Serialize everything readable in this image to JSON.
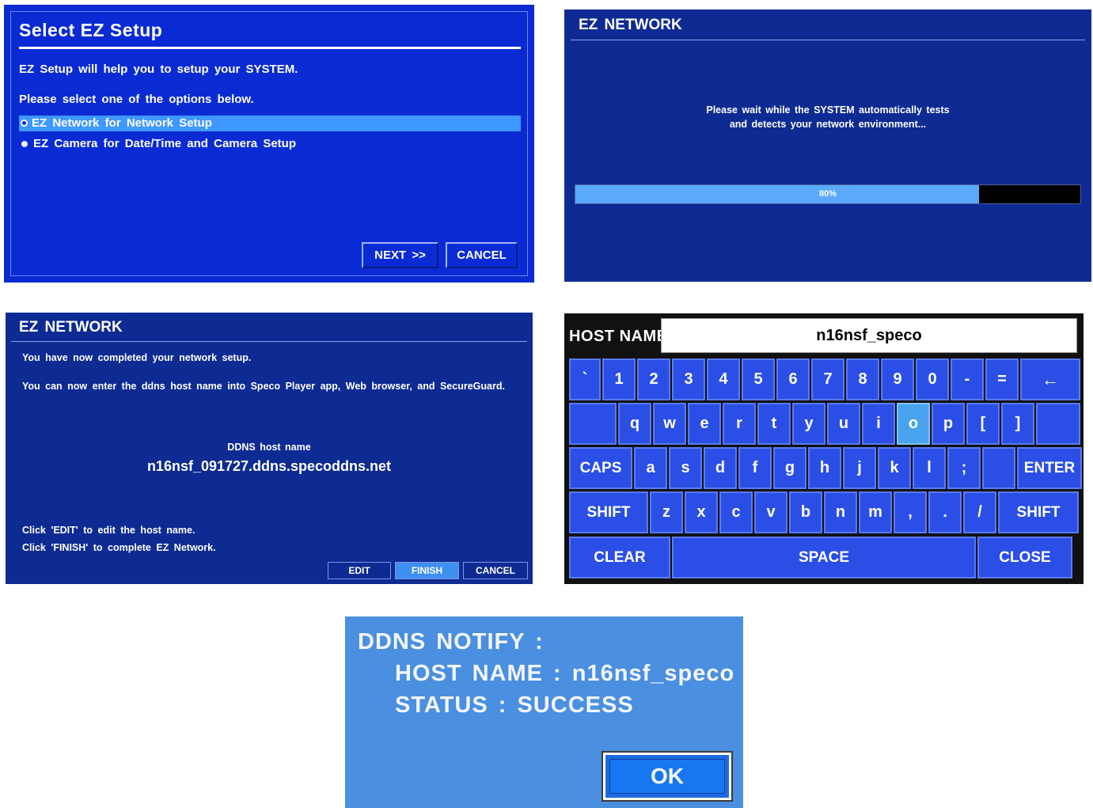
{
  "setup": {
    "title": "Select EZ Setup",
    "line1": "EZ Setup will help you to setup your SYSTEM.",
    "line2": "Please select one of the options below.",
    "options": [
      "EZ Network for Network Setup",
      "EZ Camera for Date/Time and Camera Setup"
    ],
    "next": "NEXT >>",
    "cancel": "CANCEL"
  },
  "progress": {
    "title": "EZ NETWORK",
    "msg1": "Please wait while the SYSTEM automatically tests",
    "msg2": "and detects your network environment...",
    "percent_text": "80%",
    "percent": 0.8
  },
  "complete": {
    "title": "EZ NETWORK",
    "line1": "You have now completed your network setup.",
    "line2": "You can now enter the ddns host name into Speco Player app, Web browser, and SecureGuard.",
    "host_label": "DDNS host name",
    "host_value": "n16nsf_091727.ddns.specoddns.net",
    "hint1": "Click 'EDIT' to edit the host name.",
    "hint2": "Click 'FINISH' to complete EZ Network.",
    "edit": "EDIT",
    "finish": "FINISH",
    "cancel": "CANCEL"
  },
  "keyboard": {
    "label": "HOST NAME",
    "value": "n16nsf_speco",
    "highlighted_key": "o",
    "row1": [
      "`",
      "1",
      "2",
      "3",
      "4",
      "5",
      "6",
      "7",
      "8",
      "9",
      "0",
      "-",
      "=",
      "←"
    ],
    "row2": [
      "",
      "q",
      "w",
      "e",
      "r",
      "t",
      "y",
      "u",
      "i",
      "o",
      "p",
      "[",
      "]",
      ""
    ],
    "row3": [
      "CAPS",
      "a",
      "s",
      "d",
      "f",
      "g",
      "h",
      "j",
      "k",
      "l",
      ";",
      "",
      "ENTER"
    ],
    "row4": [
      "SHIFT",
      "z",
      "x",
      "c",
      "v",
      "b",
      "n",
      "m",
      ",",
      ".",
      "/",
      "SHIFT"
    ],
    "row5": [
      "CLEAR",
      "SPACE",
      "CLOSE"
    ]
  },
  "notify": {
    "title": "DDNS  NOTIFY :",
    "host": "HOST  NAME : n16nsf_speco",
    "status": "STATUS : SUCCESS",
    "ok": "OK"
  },
  "colors": {
    "setup_bg": "#0a2bd4",
    "network_bg": "#0e2b93",
    "highlight": "#3e98ff",
    "key_bg": "#2b4fe6",
    "notify_bg": "#4a8fe0"
  }
}
